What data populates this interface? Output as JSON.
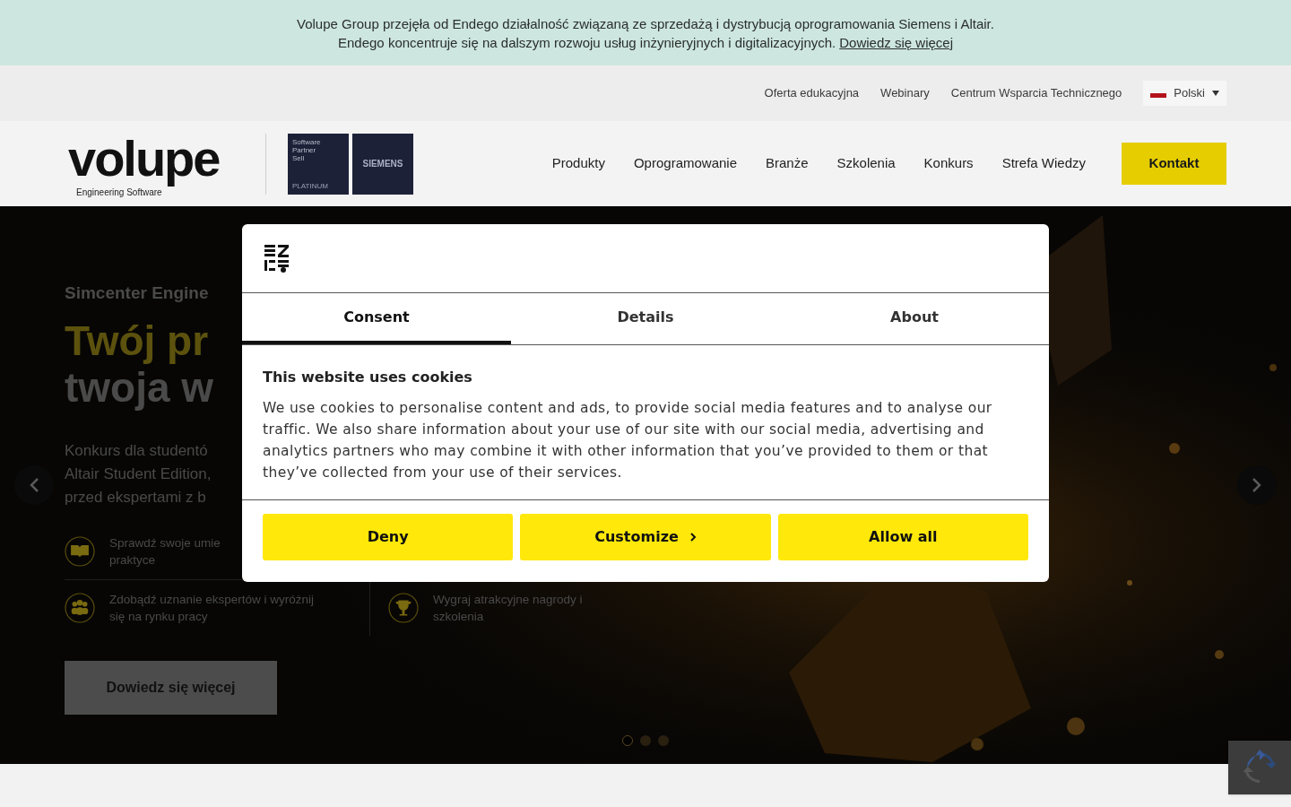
{
  "announcement": {
    "text": "Volupe Group przejęła od Endego działalność związaną ze sprzedażą i dystrybucją oprogramowania Siemens i Altair.",
    "text2": "Endego koncentruje się na dalszym rozwoju usług inżynieryjnych i digitalizacyjnych.",
    "link": "Dowiedz się więcej"
  },
  "utility_nav": [
    "Oferta edukacyjna",
    "Webinary",
    "Centrum Wsparcia Technicznego"
  ],
  "language": {
    "label": "Polski"
  },
  "logo": {
    "name": "volupe",
    "tagline": "Engineering Software"
  },
  "partner_badges": [
    {
      "lines": [
        "Software",
        "Partner",
        "Sell"
      ],
      "tier": "PLATINUM"
    },
    {
      "lines": [
        "SIEMENS"
      ]
    }
  ],
  "main_nav": [
    "Produkty",
    "Oprogramowanie",
    "Branże",
    "Szkolenia",
    "Konkurs",
    "Strefa Wiedzy"
  ],
  "contact_button": "Kontakt",
  "hero": {
    "eyebrow": "Simcenter Engine",
    "title_line1": "Twój pr",
    "title_line2": "twoja w",
    "description": [
      "Konkurs dla studentó",
      "Altair Student Edition,",
      "przed ekspertami z b"
    ],
    "features": [
      {
        "kind": "book",
        "text": [
          "Sprawdź swoje umie",
          "praktyce"
        ]
      },
      {
        "kind": "people",
        "text": [
          "Zdobądź uznanie ekspertów i wyróżnij",
          "się na rynku pracy"
        ]
      },
      {
        "kind": "trophy",
        "text": [
          "Wygraj atrakcyjne nagrody i",
          "szkolenia"
        ]
      }
    ],
    "button": "Dowiedz się więcej",
    "dots": [
      {
        "selected": true
      },
      {
        "selected": false
      },
      {
        "selected": false
      }
    ]
  },
  "cookie_dialog": {
    "tabs": [
      {
        "label": "Consent",
        "selected": true
      },
      {
        "label": "Details",
        "selected": false
      },
      {
        "label": "About",
        "selected": false
      }
    ],
    "heading": "This website uses cookies",
    "body": "We use cookies to personalise content and ads, to provide social media features and to analyse our traffic. We also share information about your use of our site with our social media, advertising and analytics partners who may combine it with other information that you’ve provided to them or that they’ve collected from your use of their services.",
    "buttons": [
      {
        "label": "Deny",
        "kind": "plain"
      },
      {
        "label": "Customize",
        "kind": "chevron"
      },
      {
        "label": "Allow all",
        "kind": "plain"
      }
    ]
  }
}
